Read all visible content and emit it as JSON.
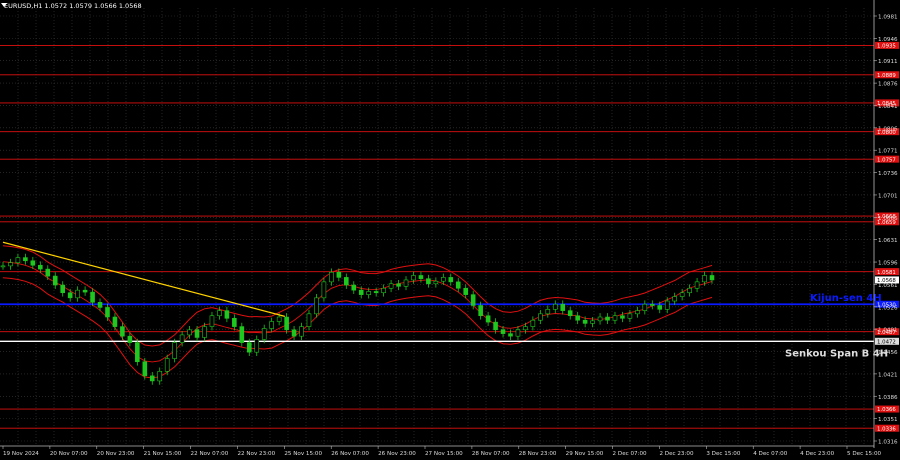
{
  "title": "EURUSD,H1  1.0572 1.0579 1.0566 1.0568",
  "colors": {
    "background": "#000000",
    "grid": "#3a3a3a",
    "level": "#e01010",
    "kijun": "#0a1aff",
    "senkou": "#ffffff",
    "trend": "#ffd200",
    "candle_up": "#1ec81e",
    "candle_down": "#1ec81e",
    "bands": "#e01010"
  },
  "chart_data": {
    "type": "candlestick",
    "symbol": "EURUSD",
    "timeframe": "H1",
    "ohlc_header": {
      "open": 1.0572,
      "high": 1.0579,
      "low": 1.0566,
      "close": 1.0568
    },
    "price_ticks": [
      "1.0981",
      "1.0946",
      "1.0911",
      "1.0876",
      "1.0841",
      "1.0806",
      "1.0771",
      "1.0736",
      "1.0701",
      "1.0666",
      "1.0631",
      "1.0596",
      "1.0561",
      "1.0526",
      "1.0491",
      "1.0456",
      "1.0421",
      "1.0386",
      "1.0351",
      "1.0316"
    ],
    "time_ticks": [
      "19 Nov 2024",
      "20 Nov 07:00",
      "20 Nov 23:00",
      "21 Nov 15:00",
      "22 Nov 07:00",
      "22 Nov 23:00",
      "25 Nov 15:00",
      "26 Nov 07:00",
      "26 Nov 23:00",
      "27 Nov 15:00",
      "28 Nov 07:00",
      "28 Nov 23:00",
      "29 Nov 15:00",
      "2 Dec 07:00",
      "2 Dec 23:00",
      "3 Dec 15:00",
      "4 Dec 07:00",
      "4 Dec 23:00",
      "5 Dec 15:00"
    ],
    "ylim": [
      1.0316,
      1.0981
    ],
    "current_price": 1.0568,
    "horizontal_levels": [
      {
        "price": 1.0935,
        "label": "1.0935",
        "color": "#e01010"
      },
      {
        "price": 1.0889,
        "label": "1.0889",
        "color": "#e01010"
      },
      {
        "price": 1.0845,
        "label": "1.0845",
        "color": "#e01010"
      },
      {
        "price": 1.08,
        "label": "1.0800",
        "color": "#e01010"
      },
      {
        "price": 1.0757,
        "label": "1.0757",
        "color": "#e01010"
      },
      {
        "price": 1.0668,
        "label": "1.0668",
        "color": "#e01010"
      },
      {
        "price": 1.0659,
        "label": "1.0659",
        "color": "#e01010"
      },
      {
        "price": 1.0581,
        "label": "1.0581",
        "color": "#e01010"
      },
      {
        "price": 1.0487,
        "label": "1.0487",
        "color": "#e01010"
      },
      {
        "price": 1.0366,
        "label": "1.0366",
        "color": "#e01010"
      },
      {
        "price": 1.0336,
        "label": "1.0336",
        "color": "#e01010"
      }
    ],
    "kijun": {
      "price": 1.053,
      "label": "1.0530",
      "name": "Kijun-sen 4H"
    },
    "senkou": {
      "price": 1.0472,
      "label": "1.0472",
      "name": "Senkou Span B 4H"
    },
    "trendline": [
      {
        "x": 0,
        "y": 1.0627
      },
      {
        "x": 95,
        "y": 1.0511
      }
    ],
    "close_series": [
      1.059,
      1.0595,
      1.0603,
      1.0598,
      1.0591,
      1.0585,
      1.0574,
      1.056,
      1.0548,
      1.054,
      1.0552,
      1.0549,
      1.0533,
      1.0525,
      1.051,
      1.0495,
      1.048,
      1.047,
      1.044,
      1.0418,
      1.041,
      1.0425,
      1.0445,
      1.047,
      1.0482,
      1.049,
      1.0478,
      1.0495,
      1.0512,
      1.052,
      1.0508,
      1.0495,
      1.047,
      1.0455,
      1.0475,
      1.0492,
      1.0503,
      1.051,
      1.049,
      1.048,
      1.0495,
      1.0515,
      1.054,
      1.0565,
      1.058,
      1.0572,
      1.056,
      1.0552,
      1.0545,
      1.055,
      1.0548,
      1.0555,
      1.0562,
      1.0558,
      1.0568,
      1.0575,
      1.057,
      1.0562,
      1.0566,
      1.0572,
      1.0565,
      1.0555,
      1.0545,
      1.0528,
      1.0512,
      1.0502,
      1.049,
      1.0484,
      1.048,
      1.049,
      1.0495,
      1.0505,
      1.0515,
      1.0522,
      1.053,
      1.052,
      1.0512,
      1.0505,
      1.05,
      1.0504,
      1.051,
      1.0505,
      1.0512,
      1.0508,
      1.0515,
      1.052,
      1.053,
      1.0528,
      1.0522,
      1.0535,
      1.0542,
      1.0548,
      1.0555,
      1.0565,
      1.0575,
      1.0568
    ]
  }
}
